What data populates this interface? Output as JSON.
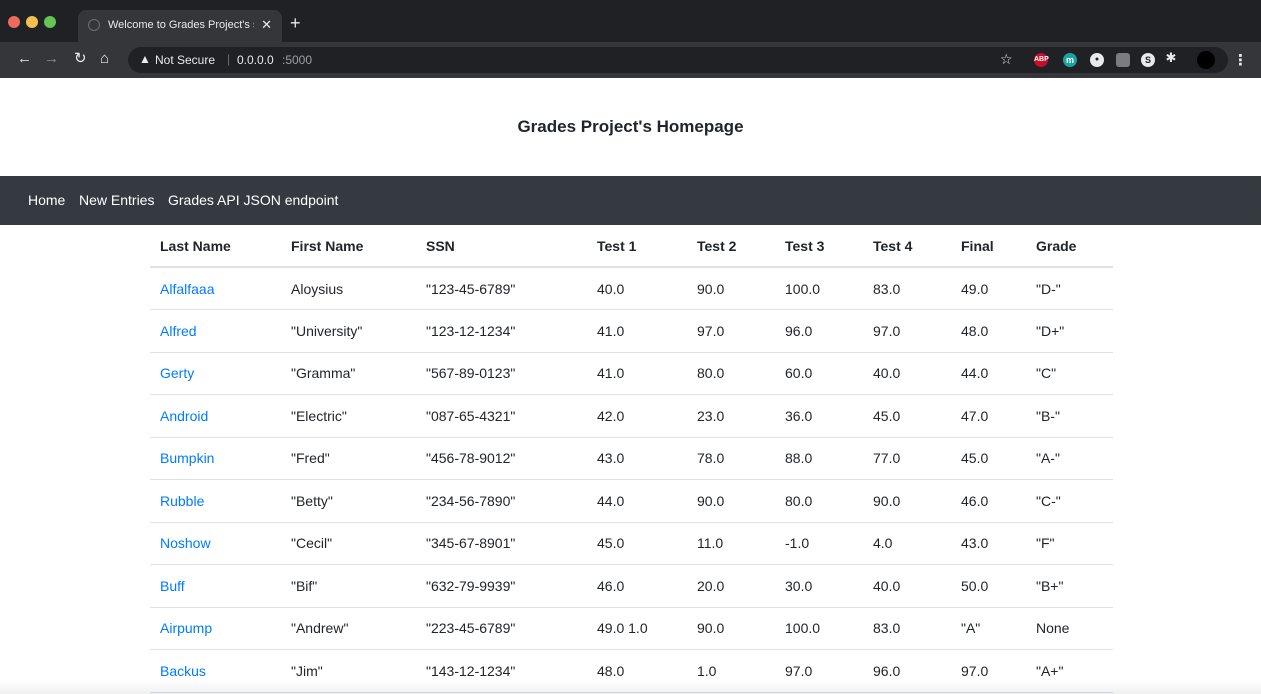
{
  "browser": {
    "tab_title": "Welcome to Grades Project's s",
    "tab_close": "✕",
    "new_tab": "+",
    "security_label": "Not Secure",
    "url_host": "0.0.0.0",
    "url_port": ":5000",
    "extensions": [
      "ABP",
      "m",
      "circle-extension",
      "square-extension",
      "S",
      "puzzle-extension"
    ]
  },
  "page": {
    "title": "Grades Project's Homepage"
  },
  "navbar": {
    "links": [
      "Home",
      "New Entries",
      "Grades API JSON endpoint"
    ]
  },
  "table": {
    "headers": [
      "Last Name",
      "First Name",
      "SSN",
      "Test 1",
      "Test 2",
      "Test 3",
      "Test 4",
      "Final",
      "Grade"
    ],
    "rows": [
      [
        "Alfalfaaa",
        "Aloysius",
        "\"123-45-6789\"",
        "40.0",
        "90.0",
        "100.0",
        "83.0",
        "49.0",
        "\"D-\""
      ],
      [
        "Alfred",
        "\"University\"",
        "\"123-12-1234\"",
        "41.0",
        "97.0",
        "96.0",
        "97.0",
        "48.0",
        "\"D+\""
      ],
      [
        "Gerty",
        "\"Gramma\"",
        "\"567-89-0123\"",
        "41.0",
        "80.0",
        "60.0",
        "40.0",
        "44.0",
        "\"C\""
      ],
      [
        "Android",
        "\"Electric\"",
        "\"087-65-4321\"",
        "42.0",
        "23.0",
        "36.0",
        "45.0",
        "47.0",
        "\"B-\""
      ],
      [
        "Bumpkin",
        "\"Fred\"",
        "\"456-78-9012\"",
        "43.0",
        "78.0",
        "88.0",
        "77.0",
        "45.0",
        "\"A-\""
      ],
      [
        "Rubble",
        "\"Betty\"",
        "\"234-56-7890\"",
        "44.0",
        "90.0",
        "80.0",
        "90.0",
        "46.0",
        "\"C-\""
      ],
      [
        "Noshow",
        "\"Cecil\"",
        "\"345-67-8901\"",
        "45.0",
        "11.0",
        "-1.0",
        "4.0",
        "43.0",
        "\"F\""
      ],
      [
        "Buff",
        "\"Bif\"",
        "\"632-79-9939\"",
        "46.0",
        "20.0",
        "30.0",
        "40.0",
        "50.0",
        "\"B+\""
      ],
      [
        "Airpump",
        "\"Andrew\"",
        "\"223-45-6789\"",
        "49.0 1.0",
        "90.0",
        "100.0",
        "83.0",
        "\"A\"",
        "None"
      ],
      [
        "Backus",
        "\"Jim\"",
        "\"143-12-1234\"",
        "48.0",
        "1.0",
        "97.0",
        "96.0",
        "97.0",
        "\"A+\""
      ]
    ]
  },
  "colors": {
    "navbar_bg": "#343a40",
    "link": "#007bff",
    "chrome_bg": "#202124"
  }
}
